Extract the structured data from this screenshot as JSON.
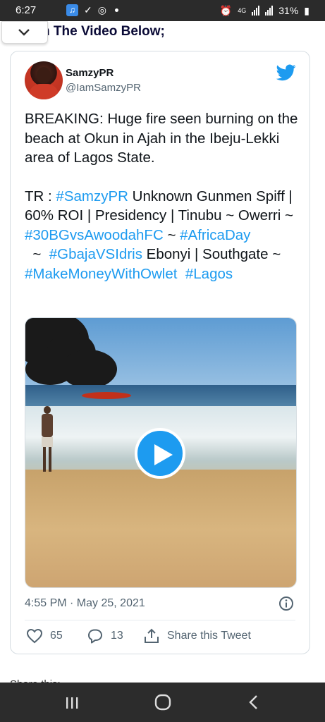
{
  "status_bar": {
    "time": "6:27",
    "battery": "31%",
    "network": "4G"
  },
  "page": {
    "heading_fragment": "n The Video Below;",
    "peek_text": "Share this:"
  },
  "tweet": {
    "author_name": "SamzyPR",
    "author_handle": "@IamSamzyPR",
    "body_line1": "BREAKING: Huge fire seen burning on the beach at Okun in Ajah in the Ibeju-Lekki area of Lagos State.",
    "tr_prefix": "TR : ",
    "tag_samzypr": "#SamzyPR",
    "text_mid1": " Unknown Gunmen Spiff | 60% ROI | Presidency | Tinubu ~ Owerri ~ ",
    "tag_30bg": "#30BGvsAwoodahFC",
    "text_mid2": " ~ ",
    "tag_africaday": "#AfricaDay",
    "text_mid3": "  ~  ",
    "tag_gbaja": "#GbajaVSIdris",
    "text_mid4": " Ebonyi | Southgate ~ ",
    "tag_makemoney": "#MakeMoneyWithOwlet",
    "text_mid5": "  ",
    "tag_lagos": "#Lagos",
    "timestamp": "4:55 PM · May 25, 2021",
    "likes": "65",
    "replies": "13",
    "share_label": "Share this Tweet"
  },
  "colors": {
    "link": "#1d9bf0",
    "heading": "#0a0a36",
    "muted": "#536471"
  },
  "icons": {
    "twitter": "twitter-bird-icon",
    "play": "play-icon",
    "info": "info-icon",
    "like": "heart-icon",
    "reply": "reply-icon",
    "share": "share-icon"
  }
}
